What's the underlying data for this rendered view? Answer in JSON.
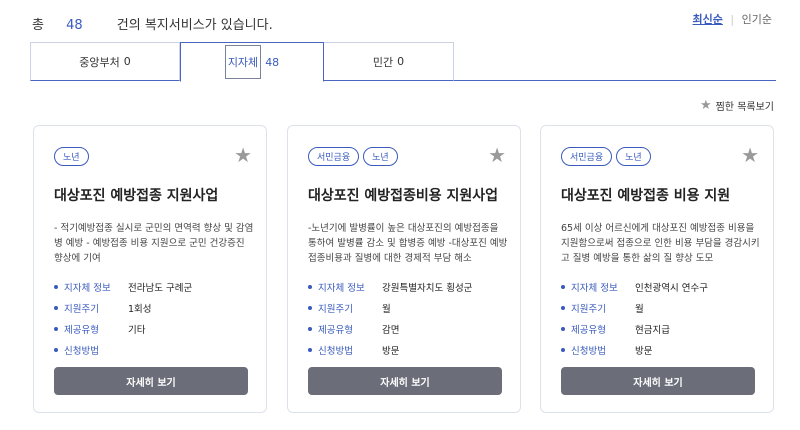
{
  "header": {
    "prefix": "총",
    "count": "48",
    "suffix": "건의 복지서비스가 있습니다."
  },
  "sort": {
    "latest": "최신순",
    "popular": "인기순"
  },
  "tabs": [
    {
      "label": "중앙부처",
      "count": "0"
    },
    {
      "label": "지자체",
      "count": "48"
    },
    {
      "label": "민간",
      "count": "0"
    }
  ],
  "fav_link": "찜한 목록보기",
  "cards": [
    {
      "tags": [
        "노년"
      ],
      "title": "대상포진 예방접종 지원사업",
      "desc": "- 적기예방접종 실시로 군민의 면역력 향상 및 감염병 예방 - 예방접종 비용 지원으로 군민 건강증진 향상에 기여",
      "info": [
        {
          "label": "지자체 정보",
          "value": "전라남도 구례군"
        },
        {
          "label": "지원주기",
          "value": "1회성"
        },
        {
          "label": "제공유형",
          "value": "기타"
        },
        {
          "label": "신청방법",
          "value": ""
        }
      ],
      "button": "자세히 보기"
    },
    {
      "tags": [
        "서민금융",
        "노년"
      ],
      "title": "대상포진 예방접종비용 지원사업",
      "desc": "-노년기에 발병률이 높은 대상포진의 예방접종을 통하여 발병률 감소 및 합병증 예방 -대상포진 예방접종비용과 질병에 대한 경제적 부담 해소",
      "info": [
        {
          "label": "지자체 정보",
          "value": "강원특별자치도 횡성군"
        },
        {
          "label": "지원주기",
          "value": "월"
        },
        {
          "label": "제공유형",
          "value": "감면"
        },
        {
          "label": "신청방법",
          "value": "방문"
        }
      ],
      "button": "자세히 보기"
    },
    {
      "tags": [
        "서민금융",
        "노년"
      ],
      "title": "대상포진 예방접종 비용 지원",
      "desc": "65세 이상 어르신에게 대상포진 예방접종 비용을 지원함으로써 접종으로 인한 비용 부담을 경감시키고 질병 예방을 통한 삶의 질 향상 도모",
      "info": [
        {
          "label": "지자체 정보",
          "value": "인천광역시 연수구"
        },
        {
          "label": "지원주기",
          "value": "월"
        },
        {
          "label": "제공유형",
          "value": "현금지급"
        },
        {
          "label": "신청방법",
          "value": "방문"
        }
      ],
      "button": "자세히 보기"
    }
  ],
  "colors": {
    "accent": "#3a5bbd",
    "button_bg": "#6b6d78",
    "star": "#9a9a9a"
  },
  "icons": {
    "favorite": "star-icon"
  }
}
